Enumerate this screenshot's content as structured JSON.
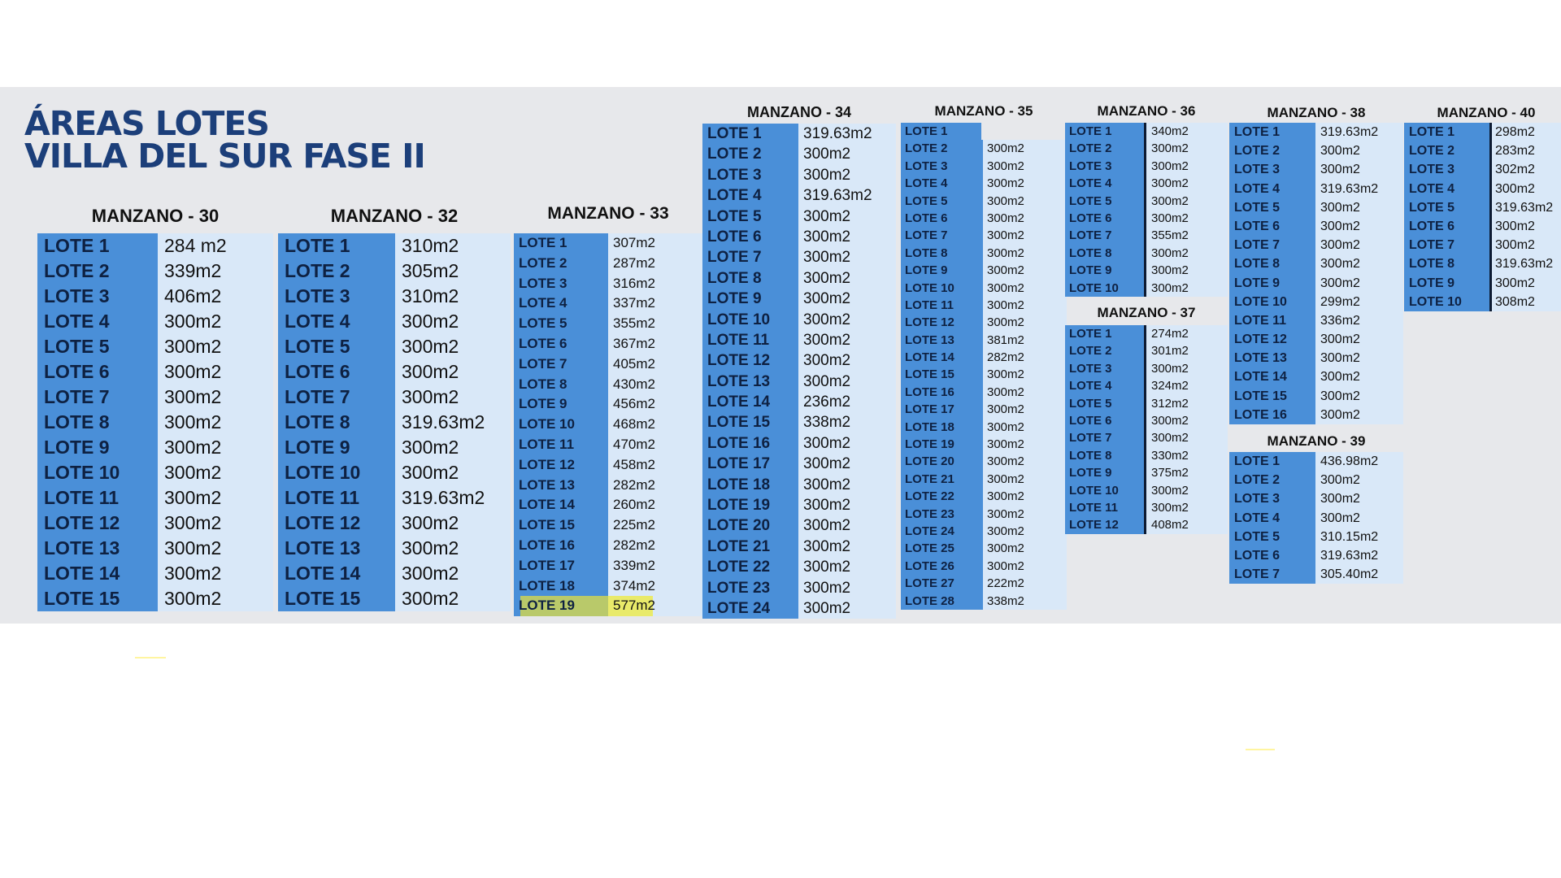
{
  "title": {
    "line1": "ÁREAS LOTES",
    "line2": "VILLA DEL SUR FASE II"
  },
  "manzanos": [
    {
      "title": "MANZANO - 30",
      "lotes": [
        [
          "LOTE 1",
          "284 m2"
        ],
        [
          "LOTE 2",
          "339m2"
        ],
        [
          "LOTE 3",
          "406m2"
        ],
        [
          "LOTE 4",
          "300m2"
        ],
        [
          "LOTE 5",
          "300m2"
        ],
        [
          "LOTE 6",
          "300m2"
        ],
        [
          "LOTE 7",
          "300m2"
        ],
        [
          "LOTE 8",
          "300m2"
        ],
        [
          "LOTE 9",
          "300m2"
        ],
        [
          "LOTE 10",
          "300m2"
        ],
        [
          "LOTE 11",
          "300m2"
        ],
        [
          "LOTE 12",
          "300m2"
        ],
        [
          "LOTE 13",
          "300m2"
        ],
        [
          "LOTE 14",
          "300m2"
        ],
        [
          "LOTE 15",
          "300m2"
        ]
      ]
    },
    {
      "title": "MANZANO - 32",
      "lotes": [
        [
          "LOTE 1",
          "310m2"
        ],
        [
          "LOTE 2",
          "305m2"
        ],
        [
          "LOTE 3",
          "310m2"
        ],
        [
          "LOTE 4",
          "300m2"
        ],
        [
          "LOTE 5",
          "300m2"
        ],
        [
          "LOTE 6",
          "300m2"
        ],
        [
          "LOTE 7",
          "300m2"
        ],
        [
          "LOTE 8",
          "319.63m2"
        ],
        [
          "LOTE 9",
          "300m2"
        ],
        [
          "LOTE 10",
          "300m2"
        ],
        [
          "LOTE 11",
          "319.63m2"
        ],
        [
          "LOTE 12",
          "300m2"
        ],
        [
          "LOTE 13",
          "300m2"
        ],
        [
          "LOTE 14",
          "300m2"
        ],
        [
          "LOTE 15",
          "300m2"
        ]
      ]
    },
    {
      "title": "MANZANO - 33",
      "highlighted_lote": "LOTE 19",
      "lotes": [
        [
          "LOTE 1",
          "307m2"
        ],
        [
          "LOTE 2",
          "287m2"
        ],
        [
          "LOTE 3",
          "316m2"
        ],
        [
          "LOTE 4",
          "337m2"
        ],
        [
          "LOTE 5",
          "355m2"
        ],
        [
          "LOTE 6",
          "367m2"
        ],
        [
          "LOTE 7",
          "405m2"
        ],
        [
          "LOTE 8",
          "430m2"
        ],
        [
          "LOTE 9",
          "456m2"
        ],
        [
          "LOTE 10",
          "468m2"
        ],
        [
          "LOTE 11",
          "470m2"
        ],
        [
          "LOTE 12",
          "458m2"
        ],
        [
          "LOTE 13",
          "282m2"
        ],
        [
          "LOTE 14",
          "260m2"
        ],
        [
          "LOTE 15",
          "225m2"
        ],
        [
          "LOTE 16",
          "282m2"
        ],
        [
          "LOTE 17",
          "339m2"
        ],
        [
          "LOTE 18",
          "374m2"
        ],
        [
          "LOTE 19",
          "577m2"
        ]
      ]
    },
    {
      "title": "MANZANO - 34",
      "lotes": [
        [
          "LOTE 1",
          "319.63m2"
        ],
        [
          "LOTE 2",
          "300m2"
        ],
        [
          "LOTE 3",
          "300m2"
        ],
        [
          "LOTE 4",
          "319.63m2"
        ],
        [
          "LOTE 5",
          "300m2"
        ],
        [
          "LOTE 6",
          "300m2"
        ],
        [
          "LOTE 7",
          "300m2"
        ],
        [
          "LOTE 8",
          "300m2"
        ],
        [
          "LOTE 9",
          "300m2"
        ],
        [
          "LOTE 10",
          "300m2"
        ],
        [
          "LOTE 11",
          "300m2"
        ],
        [
          "LOTE 12",
          "300m2"
        ],
        [
          "LOTE 13",
          "300m2"
        ],
        [
          "LOTE 14",
          "236m2"
        ],
        [
          "LOTE 15",
          "338m2"
        ],
        [
          "LOTE 16",
          "300m2"
        ],
        [
          "LOTE 17",
          "300m2"
        ],
        [
          "LOTE 18",
          "300m2"
        ],
        [
          "LOTE 19",
          "300m2"
        ],
        [
          "LOTE 20",
          "300m2"
        ],
        [
          "LOTE 21",
          "300m2"
        ],
        [
          "LOTE 22",
          "300m2"
        ],
        [
          "LOTE 23",
          "300m2"
        ],
        [
          "LOTE 24",
          "300m2"
        ]
      ]
    },
    {
      "title": "MANZANO - 35",
      "lotes": [
        [
          "LOTE 1",
          ""
        ],
        [
          "LOTE 2",
          "300m2"
        ],
        [
          "LOTE 3",
          "300m2"
        ],
        [
          "LOTE 4",
          "300m2"
        ],
        [
          "LOTE 5",
          "300m2"
        ],
        [
          "LOTE 6",
          "300m2"
        ],
        [
          "LOTE 7",
          "300m2"
        ],
        [
          "LOTE 8",
          "300m2"
        ],
        [
          "LOTE 9",
          "300m2"
        ],
        [
          "LOTE 10",
          "300m2"
        ],
        [
          "LOTE 11",
          "300m2"
        ],
        [
          "LOTE 12",
          "300m2"
        ],
        [
          "LOTE 13",
          "381m2"
        ],
        [
          "LOTE 14",
          "282m2"
        ],
        [
          "LOTE 15",
          "300m2"
        ],
        [
          "LOTE 16",
          "300m2"
        ],
        [
          "LOTE 17",
          "300m2"
        ],
        [
          "LOTE 18",
          "300m2"
        ],
        [
          "LOTE 19",
          "300m2"
        ],
        [
          "LOTE 20",
          "300m2"
        ],
        [
          "LOTE 21",
          "300m2"
        ],
        [
          "LOTE 22",
          "300m2"
        ],
        [
          "LOTE 23",
          "300m2"
        ],
        [
          "LOTE 24",
          "300m2"
        ],
        [
          "LOTE 25",
          "300m2"
        ],
        [
          "LOTE 26",
          "300m2"
        ],
        [
          "LOTE 27",
          "222m2"
        ],
        [
          "LOTE 28",
          "338m2"
        ]
      ]
    },
    {
      "title": "MANZANO - 36",
      "lotes": [
        [
          "LOTE 1",
          "340m2"
        ],
        [
          "LOTE 2",
          "300m2"
        ],
        [
          "LOTE 3",
          "300m2"
        ],
        [
          "LOTE 4",
          "300m2"
        ],
        [
          "LOTE 5",
          "300m2"
        ],
        [
          "LOTE 6",
          "300m2"
        ],
        [
          "LOTE 7",
          "355m2"
        ],
        [
          "LOTE 8",
          "300m2"
        ],
        [
          "LOTE 9",
          "300m2"
        ],
        [
          "LOTE 10",
          "300m2"
        ]
      ]
    },
    {
      "title": "MANZANO - 37",
      "lotes": [
        [
          "LOTE 1",
          "274m2"
        ],
        [
          "LOTE 2",
          "301m2"
        ],
        [
          "LOTE 3",
          "300m2"
        ],
        [
          "LOTE 4",
          "324m2"
        ],
        [
          "LOTE 5",
          "312m2"
        ],
        [
          "LOTE 6",
          "300m2"
        ],
        [
          "LOTE 7",
          "300m2"
        ],
        [
          "LOTE 8",
          "330m2"
        ],
        [
          "LOTE 9",
          "375m2"
        ],
        [
          "LOTE 10",
          "300m2"
        ],
        [
          "LOTE 11",
          "300m2"
        ],
        [
          "LOTE 12",
          "408m2"
        ]
      ]
    },
    {
      "title": "MANZANO - 38",
      "lotes": [
        [
          "LOTE 1",
          "319.63m2"
        ],
        [
          "LOTE 2",
          "300m2"
        ],
        [
          "LOTE 3",
          "300m2"
        ],
        [
          "LOTE 4",
          "319.63m2"
        ],
        [
          "LOTE 5",
          "300m2"
        ],
        [
          "LOTE 6",
          "300m2"
        ],
        [
          "LOTE 7",
          "300m2"
        ],
        [
          "LOTE 8",
          "300m2"
        ],
        [
          "LOTE 9",
          "300m2"
        ],
        [
          "LOTE 10",
          "299m2"
        ],
        [
          "LOTE 11",
          "336m2"
        ],
        [
          "LOTE 12",
          "300m2"
        ],
        [
          "LOTE 13",
          "300m2"
        ],
        [
          "LOTE 14",
          "300m2"
        ],
        [
          "LOTE 15",
          "300m2"
        ],
        [
          "LOTE 16",
          "300m2"
        ]
      ]
    },
    {
      "title": "MANZANO - 39",
      "lotes": [
        [
          "LOTE 1",
          "436.98m2"
        ],
        [
          "LOTE 2",
          "300m2"
        ],
        [
          "LOTE 3",
          "300m2"
        ],
        [
          "LOTE 4",
          "300m2"
        ],
        [
          "LOTE 5",
          "310.15m2"
        ],
        [
          "LOTE 6",
          "319.63m2"
        ],
        [
          "LOTE 7",
          "305.40m2"
        ]
      ]
    },
    {
      "title": "MANZANO - 40",
      "lotes": [
        [
          "LOTE 1",
          "298m2"
        ],
        [
          "LOTE 2",
          "283m2"
        ],
        [
          "LOTE 3",
          "302m2"
        ],
        [
          "LOTE 4",
          "300m2"
        ],
        [
          "LOTE 5",
          "319.63m2"
        ],
        [
          "LOTE 6",
          "300m2"
        ],
        [
          "LOTE 7",
          "300m2"
        ],
        [
          "LOTE 8",
          "319.63m2"
        ],
        [
          "LOTE 9",
          "300m2"
        ],
        [
          "LOTE 10",
          "308m2"
        ]
      ]
    }
  ],
  "colors": {
    "title": "#1c3f7a",
    "label_bg": "#4a8fd8",
    "value_bg": "#d9e8f8",
    "band_bg": "#e7e8eb",
    "highlight": "#e9ea6a"
  }
}
